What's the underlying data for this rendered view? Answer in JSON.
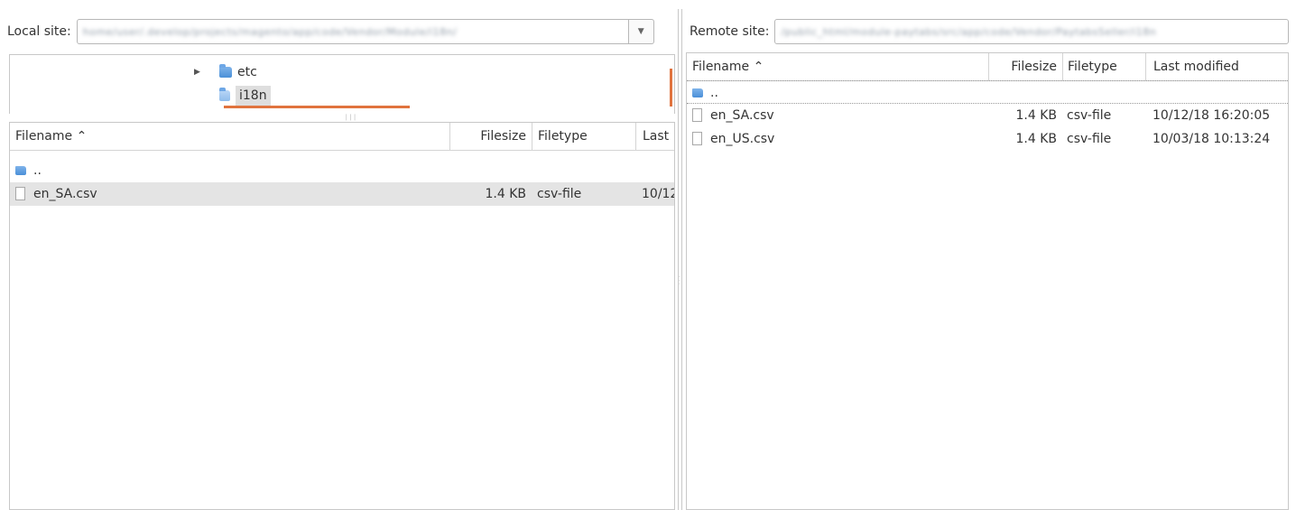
{
  "local": {
    "site_label": "Local site:",
    "site_path": "home/user/.develop/projects/magento/app/code/Vendor/Module/i18n/",
    "tree": {
      "items": [
        {
          "label": "etc",
          "expandable": true
        },
        {
          "label": "i18n",
          "selected": true
        }
      ]
    },
    "columns": [
      "Filename ⌃",
      "Filesize",
      "Filetype",
      "Last"
    ],
    "rows": [
      {
        "name": "..",
        "size": "",
        "type": "",
        "modified": ""
      },
      {
        "name": "en_SA.csv",
        "size": "1.4 KB",
        "type": "csv-file",
        "modified": "10/12"
      }
    ]
  },
  "remote": {
    "site_label": "Remote site:",
    "site_path": "/public_html/module-paytabs/src/app/code/Vendor/PaytabsSeller/i18n",
    "columns": [
      "Filename ⌃",
      "Filesize",
      "Filetype",
      "Last modified"
    ],
    "rows": [
      {
        "name": "..",
        "size": "",
        "type": "",
        "modified": ""
      },
      {
        "name": "en_SA.csv",
        "size": "1.4 KB",
        "type": "csv-file",
        "modified": "10/12/18 16:20:05"
      },
      {
        "name": "en_US.csv",
        "size": "1.4 KB",
        "type": "csv-file",
        "modified": "10/03/18 10:13:24"
      }
    ]
  },
  "colors": {
    "accent": "#e0733e",
    "folder": "#4a8fd8",
    "selection": "#e4e4e4"
  }
}
